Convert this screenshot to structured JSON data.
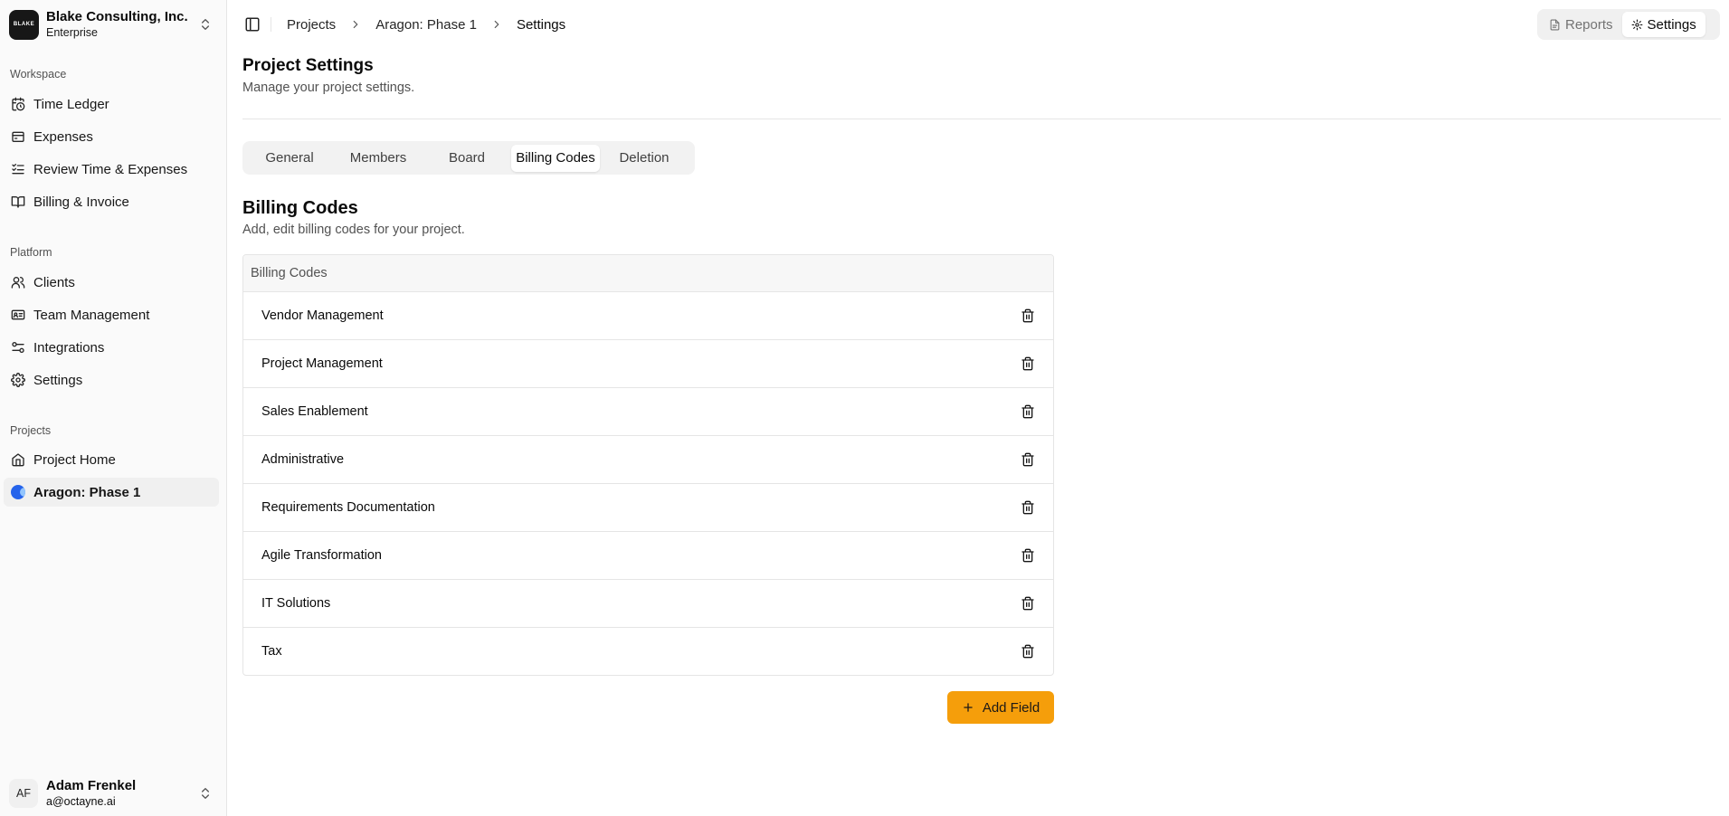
{
  "colors": {
    "accent": "#f59e0b",
    "project_dot": "#2563eb"
  },
  "sidebar": {
    "org": {
      "logo_text": "BLAKE",
      "name": "Blake Consulting, Inc.",
      "plan": "Enterprise"
    },
    "workspace_label": "Workspace",
    "workspace_items": [
      {
        "label": "Time Ledger",
        "icon": "clock-calendar-icon"
      },
      {
        "label": "Expenses",
        "icon": "wallet-icon"
      },
      {
        "label": "Review Time & Expenses",
        "icon": "checklist-icon"
      },
      {
        "label": "Billing & Invoice",
        "icon": "book-open-icon"
      }
    ],
    "platform_label": "Platform",
    "platform_items": [
      {
        "label": "Clients",
        "icon": "users-icon"
      },
      {
        "label": "Team Management",
        "icon": "id-card-icon"
      },
      {
        "label": "Integrations",
        "icon": "sliders-icon"
      },
      {
        "label": "Settings",
        "icon": "gear-icon"
      }
    ],
    "projects_label": "Projects",
    "project_items": [
      {
        "label": "Project Home",
        "icon": "home-icon"
      },
      {
        "label": "Aragon: Phase 1",
        "icon": "project-dot-icon",
        "active": true
      }
    ],
    "user": {
      "initials": "AF",
      "name": "Adam Frenkel",
      "email": "a@octayne.ai"
    }
  },
  "header": {
    "breadcrumb": [
      "Projects",
      "Aragon: Phase 1",
      "Settings"
    ],
    "view_switch": {
      "reports": "Reports",
      "settings": "Settings",
      "active": "settings"
    }
  },
  "main": {
    "title": "Project Settings",
    "subtitle": "Manage your project settings.",
    "tabs": [
      "General",
      "Members",
      "Board",
      "Billing Codes",
      "Deletion"
    ],
    "active_tab": "Billing Codes",
    "section_title": "Billing Codes",
    "section_subtitle": "Add, edit billing codes for your project.",
    "table_header": "Billing Codes",
    "billing_codes": [
      "Vendor Management",
      "Project Management",
      "Sales Enablement",
      "Administrative",
      "Requirements Documentation",
      "Agile Transformation",
      "IT Solutions",
      "Tax"
    ],
    "add_button": "Add Field"
  }
}
